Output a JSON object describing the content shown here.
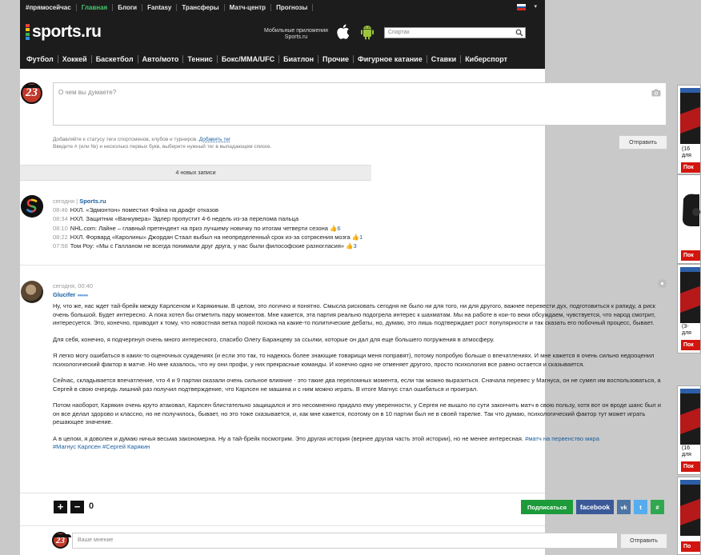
{
  "topbar": {
    "links": [
      {
        "label": "#прямосейчас",
        "active": false
      },
      {
        "label": "Главная",
        "active": true
      },
      {
        "label": "Блоги",
        "active": false
      },
      {
        "label": "Fantasy",
        "active": false
      },
      {
        "label": "Трансферы",
        "active": false
      },
      {
        "label": "Матч-центр",
        "active": false
      },
      {
        "label": "Прогнозы",
        "active": false
      }
    ],
    "flag_colors": [
      "#ffffff",
      "#1c57a5",
      "#d52b1e"
    ]
  },
  "logo": {
    "text": "sports.ru",
    "dot_colors": [
      "#e8413b",
      "#f3c21b",
      "#3fb34f",
      "#2f8fdd"
    ]
  },
  "apps": {
    "line1": "Мобильные приложения",
    "line2": "Sports.ru",
    "apple_icon": "apple-icon",
    "android_icon": "android-icon",
    "android_color": "#9bc53d"
  },
  "search": {
    "placeholder": "Спартак"
  },
  "nav": {
    "items": [
      "Футбол",
      "Хоккей",
      "Баскетбол",
      "Авто/мото",
      "Теннис",
      "Бокс/MMA/UFC",
      "Биатлон",
      "Прочие",
      "Фигурное катание",
      "Ставки",
      "Киберспорт"
    ]
  },
  "composer": {
    "avatar_number": "23",
    "placeholder": "О чем вы думаете?",
    "hint_line1": "Добавляйте к статусу теги спортсменов, клубов и турниров.",
    "hint_link": "Добавить тег",
    "hint_line2": "Введите # (или №) и несколько первых букв, выберите нужный тег в выпадающем списке.",
    "submit": "Отправить"
  },
  "new_posts": "4 новых записи",
  "feed": {
    "date": "сегодня",
    "separator": "|",
    "source": "Sports.ru",
    "items": [
      {
        "time": "08:46",
        "text": "НХЛ. «Эдмонтон» поместил Фэйна на драфт отказов",
        "count": ""
      },
      {
        "time": "08:34",
        "text": "НХЛ. Защитник «Ванкувера» Эдлер пропустит 4-6 недель из-за перелома пальца",
        "count": ""
      },
      {
        "time": "08:10",
        "text": "NHL.com: Лайне – главный претендент на приз лучшему новичку по итогам четверти сезона",
        "count": "6"
      },
      {
        "time": "08:22",
        "text": "НХЛ. Форвард «Каролины» Джордан Стаал выбыл на неопределенный срок из-за сотрясения мозга",
        "count": "1"
      },
      {
        "time": "07:58",
        "text": "Том Роу: «Мы с Галланом не всегда понимали друг друга, у нас были философские разногласия»",
        "count": "3"
      }
    ]
  },
  "post": {
    "date": "сегодня, 00:40",
    "author": "Glucifer",
    "rating_dots": "●●●●●",
    "paragraphs": [
      "Ну, что же, нас ждет тай-брейк между Карлсеном и Карякиным. В целом, это логично и понятно. Смысла рисковать сегодня не было ни для того, ни для другого, важнее перевести дух, подготовиться к рапиду, а риск очень большой. Будет интересно. А пока хотел бы отметить пару моментов. Мне кажется, эта партия реально подогрела интерес к шахматам. Мы на работе в кои-то веки обсуждаем, чувствуется, что народ смотрит, интересуется. Это, конечно, приводит к тому, что новостная ветка порой похожа на какие-то политические дебаты, но, думаю, это лишь подтверждает рост популярности и так сказать его побочный процесс, бывает.",
      "Для себя, конечно, я подчерпнул очень много интересного, спасибо Олегу Баранцеву за ссылки, которые он дал для еще большего погружения в атмосферу.",
      "Я легко могу ошибаться в каких-то оценочных суждениях (и если это так, то надеюсь более знающие товарищи меня поправят), потому попробую больше о впечатлениях. И мне кажется я очень сильно недооценил психологический фактор в матче. Но мне казалось, что ну они профи, у них прекрасные команды. И конечно одно не отменяет другого, просто психология все равно остается и сказывается.",
      "Сейчас, складывается впечатление, что 4 и 9 партии оказали очень сильное влияние - это такие два переломных момента, если так можно выразиться. Сначала перевес у Магнуса, он не сумел им воспользоваться, а Сергей в свою очередь лишний раз получил подтверждение, что Карлсен не машина и с ним можно играть. В итоге Магнус стал ошибаться и проиграл.",
      "Потом наоборот, Карякин очень круто атаковал, Карлсен блистательно защищался и это несомненно придало ему уверенности, у Сергея не вышло по сути закончить матч в свою пользу, хотя вот он вроде шанс был и он все делал здорово и классно, но не получилось, бывает, но это тоже сказывается, и, как мне кажется, поэтому он в 10 партии был не в своей тарелке. Так что думаю, психологический фактор тут может играть решающее значение."
    ],
    "last_paragraph": "А в целом, я доволен и думаю ничья весьма закономерна. Ну а тай-брейк посмотрим. Это другая история (вернее другая часть этой истории), но не менее интересная.",
    "tags": [
      "#матч на первенство мира",
      "#Магнус Карлсен",
      "#Сергей Карякин"
    ]
  },
  "actions": {
    "plus": "+",
    "minus": "−",
    "rating": "0",
    "subscribe": "Подписаться",
    "facebook": "facebook",
    "vk": "vk",
    "twitter": "t",
    "other": "#",
    "subscribe_color": "#1d9b3a",
    "facebook_color": "#3b5998",
    "vk_color": "#4c75a3",
    "twitter_color": "#55acee",
    "other_color": "#2fa84f"
  },
  "comment": {
    "avatar_number": "23",
    "placeholder": "Ваше мнение",
    "submit": "Отправить"
  },
  "ads": [
    {
      "line1": "(16",
      "line2": "для",
      "button": "Пок"
    },
    {
      "line1": "",
      "line2": "",
      "button": "Пок"
    },
    {
      "line1": "(3-",
      "line2": "для",
      "button": "Пок"
    },
    {
      "line1": "(16",
      "line2": "для",
      "button": "Пок"
    },
    {
      "line1": "",
      "line2": "",
      "button": "По"
    }
  ]
}
